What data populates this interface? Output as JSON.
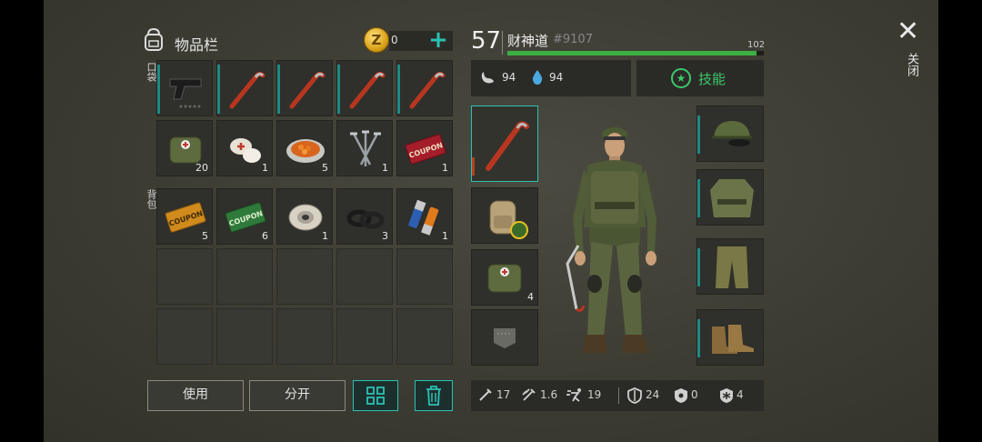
{
  "inventory": {
    "title": "物品栏",
    "coins": "0",
    "coin_glyph": "Z",
    "pocket_label": "口袋",
    "backpack_label": "背包",
    "pocket_slots": [
      {
        "icon": "pistol-icon",
        "qty": ""
      },
      {
        "icon": "crowbar-icon",
        "qty": ""
      },
      {
        "icon": "crowbar-icon",
        "qty": ""
      },
      {
        "icon": "crowbar-icon",
        "qty": ""
      },
      {
        "icon": "crowbar-icon",
        "qty": ""
      },
      {
        "icon": "medkit-bag-icon",
        "qty": "20"
      },
      {
        "icon": "bandage-icon",
        "qty": "1"
      },
      {
        "icon": "food-bowl-icon",
        "qty": "5"
      },
      {
        "icon": "nails-icon",
        "qty": "1"
      },
      {
        "icon": "coupon-red-icon",
        "qty": "1",
        "text": "COUPON"
      }
    ],
    "backpack_slots": [
      {
        "icon": "coupon-orange-icon",
        "qty": "5",
        "text": "COUPON"
      },
      {
        "icon": "coupon-green-icon",
        "qty": "6",
        "text": "COUPON"
      },
      {
        "icon": "wire-spool-icon",
        "qty": "1"
      },
      {
        "icon": "rubber-seal-icon",
        "qty": "3"
      },
      {
        "icon": "batteries-icon",
        "qty": "1"
      }
    ],
    "buttons": {
      "use": "使用",
      "split": "分开"
    }
  },
  "character": {
    "level": "57",
    "name": "财神道",
    "id": "#9107",
    "xp_max": "102",
    "xp_fraction": 0.97,
    "hunger": "94",
    "thirst": "94",
    "skills_label": "技能",
    "backpack_qty": "",
    "medkit_qty": "4"
  },
  "combat": {
    "damage": "17",
    "attack_speed": "1.6",
    "move_speed": "19",
    "armor": "24",
    "bio_protection": "0",
    "cold_protection": "4"
  },
  "close_label": "关闭",
  "colors": {
    "accent": "#2bc1b4",
    "xp": "#3cb043",
    "skill": "#3cc86a"
  }
}
